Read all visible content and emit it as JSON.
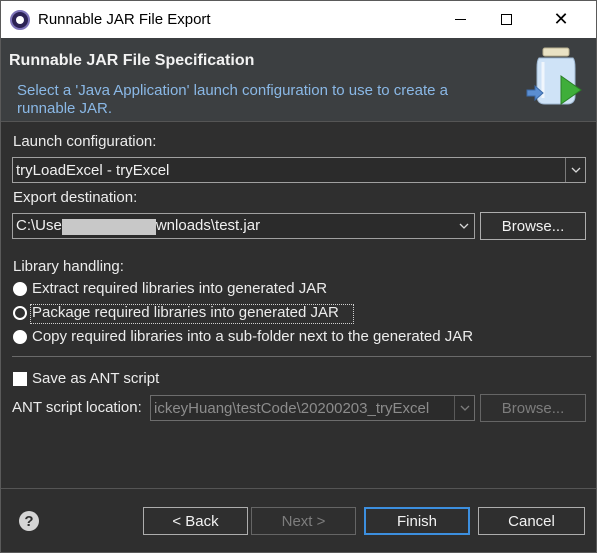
{
  "window": {
    "title": "Runnable JAR File Export",
    "icon": "eclipse-icon"
  },
  "banner": {
    "title": "Runnable JAR File Specification",
    "description": "Select a 'Java Application' launch configuration to use to create a runnable JAR.",
    "icon": "jar-export-icon"
  },
  "launch": {
    "label": "Launch configuration:",
    "value": "tryLoadExcel - tryExcel"
  },
  "export": {
    "label": "Export destination:",
    "value_start": "C:\\Use",
    "value_end": "wnloads\\test.jar",
    "browse_label": "Browse..."
  },
  "library": {
    "label": "Library handling:",
    "options": [
      {
        "label": "Extract required libraries into generated JAR",
        "selected": false
      },
      {
        "label": "Package required libraries into generated JAR",
        "selected": true
      },
      {
        "label": "Copy required libraries into a sub-folder next to the generated JAR",
        "selected": false
      }
    ]
  },
  "ant": {
    "checkbox_label": "Save as ANT script",
    "checked": false,
    "location_label": "ANT script location:",
    "location_value": "ickeyHuang\\testCode\\20200203_tryExcel",
    "browse_label": "Browse..."
  },
  "footer": {
    "help_icon": "?",
    "back_label": "< Back",
    "next_label": "Next >",
    "finish_label": "Finish",
    "cancel_label": "Cancel"
  },
  "colors": {
    "background": "#2f2f2f",
    "banner_desc": "#8ab8e6",
    "default_button_border": "#3c8fdf"
  }
}
